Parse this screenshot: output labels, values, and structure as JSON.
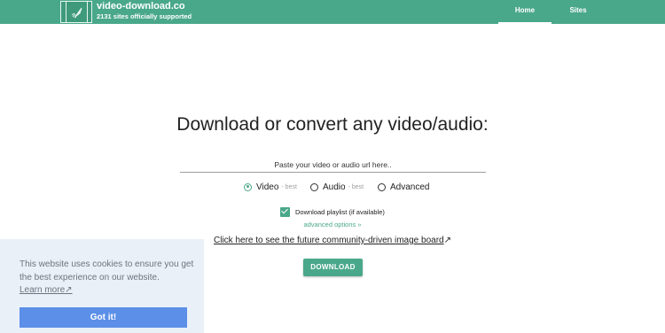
{
  "navbar": {
    "brand_title": "video-download.co",
    "brand_subtitle": "2131 sites officially supported",
    "logo_icon": "film-rocket-icon",
    "links": [
      {
        "label": "Home",
        "active": true
      },
      {
        "label": "Sites",
        "active": false
      }
    ],
    "bg_color": "#4aa88a"
  },
  "main": {
    "headline": "Download or convert any video/audio:",
    "url_input": {
      "value": "",
      "placeholder": "Paste your video or audio url here.."
    },
    "format_options": [
      {
        "label": "Video",
        "sub": "- best",
        "selected": true
      },
      {
        "label": "Audio",
        "sub": "- best",
        "selected": false
      },
      {
        "label": "Advanced",
        "sub": "",
        "selected": false
      }
    ],
    "playlist_checkbox": {
      "label": "Download playlist (if available)",
      "checked": true
    },
    "advanced_options_link": "advanced options »",
    "future_link": "Click here to see the future community-driven image board",
    "future_link_icon": "external-link-icon",
    "download_button": "DOWNLOAD"
  },
  "cookie_banner": {
    "message": "This website uses cookies to ensure you get the best experience on our website.",
    "learn_more": "Learn more",
    "accept_button": "Got it!",
    "button_color": "#5b8fe8"
  }
}
